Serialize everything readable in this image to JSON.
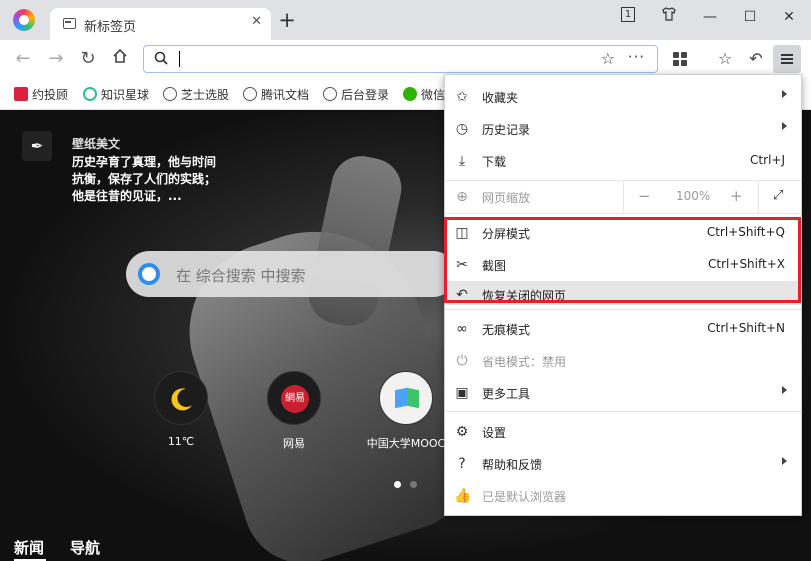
{
  "tab": {
    "title": "新标签页",
    "close": "✕",
    "new_tab": "+"
  },
  "window": {
    "tab_count": "1"
  },
  "address_bar": {
    "value": ""
  },
  "bookmarks": [
    {
      "label": "约投顾",
      "icon": "ribbon-icon",
      "color": "#d9233c"
    },
    {
      "label": "知识星球",
      "icon": "planet-icon",
      "color": "#2fbf8c"
    },
    {
      "label": "芝士选股",
      "icon": "globe-icon",
      "color": "#555555"
    },
    {
      "label": "腾讯文档",
      "icon": "globe-icon",
      "color": "#555555"
    },
    {
      "label": "后台登录",
      "icon": "globe-icon",
      "color": "#555555"
    },
    {
      "label": "微信",
      "icon": "wechat-icon",
      "color": "#2db300"
    }
  ],
  "wallpaper": {
    "title": "壁纸美文",
    "quote": "历史孕育了真理，他与时间抗衡，保存了人们的实践；他是往昔的见证，..."
  },
  "search": {
    "placeholder": "在 综合搜索 中搜索"
  },
  "quick_links": [
    {
      "label": "11℃",
      "icon": "moon-weather-icon"
    },
    {
      "label": "网易",
      "icon": "netease-icon",
      "badge": "網易"
    },
    {
      "label": "中国大学MOOC",
      "icon": "mooc-icon"
    }
  ],
  "bottom_tabs": {
    "news": "新闻",
    "nav": "导航"
  },
  "menu": {
    "favorites": "收藏夹",
    "history": "历史记录",
    "downloads": {
      "label": "下载",
      "shortcut": "Ctrl+J"
    },
    "zoom": {
      "label": "网页缩放",
      "minus": "−",
      "value": "100%",
      "plus": "+"
    },
    "split_screen": {
      "label": "分屏模式",
      "shortcut": "Ctrl+Shift+Q"
    },
    "screenshot": {
      "label": "截图",
      "shortcut": "Ctrl+Shift+X"
    },
    "restore_closed": {
      "label": "恢复关闭的网页"
    },
    "incognito": {
      "label": "无痕模式",
      "shortcut": "Ctrl+Shift+N"
    },
    "power_saving": {
      "label": "省电模式：禁用"
    },
    "more_tools": "更多工具",
    "settings": "设置",
    "help": "帮助和反馈",
    "default_browser": "已是默认浏览器"
  },
  "colors": {
    "highlight": "#e5202a",
    "address_border": "#9ec1f2"
  }
}
